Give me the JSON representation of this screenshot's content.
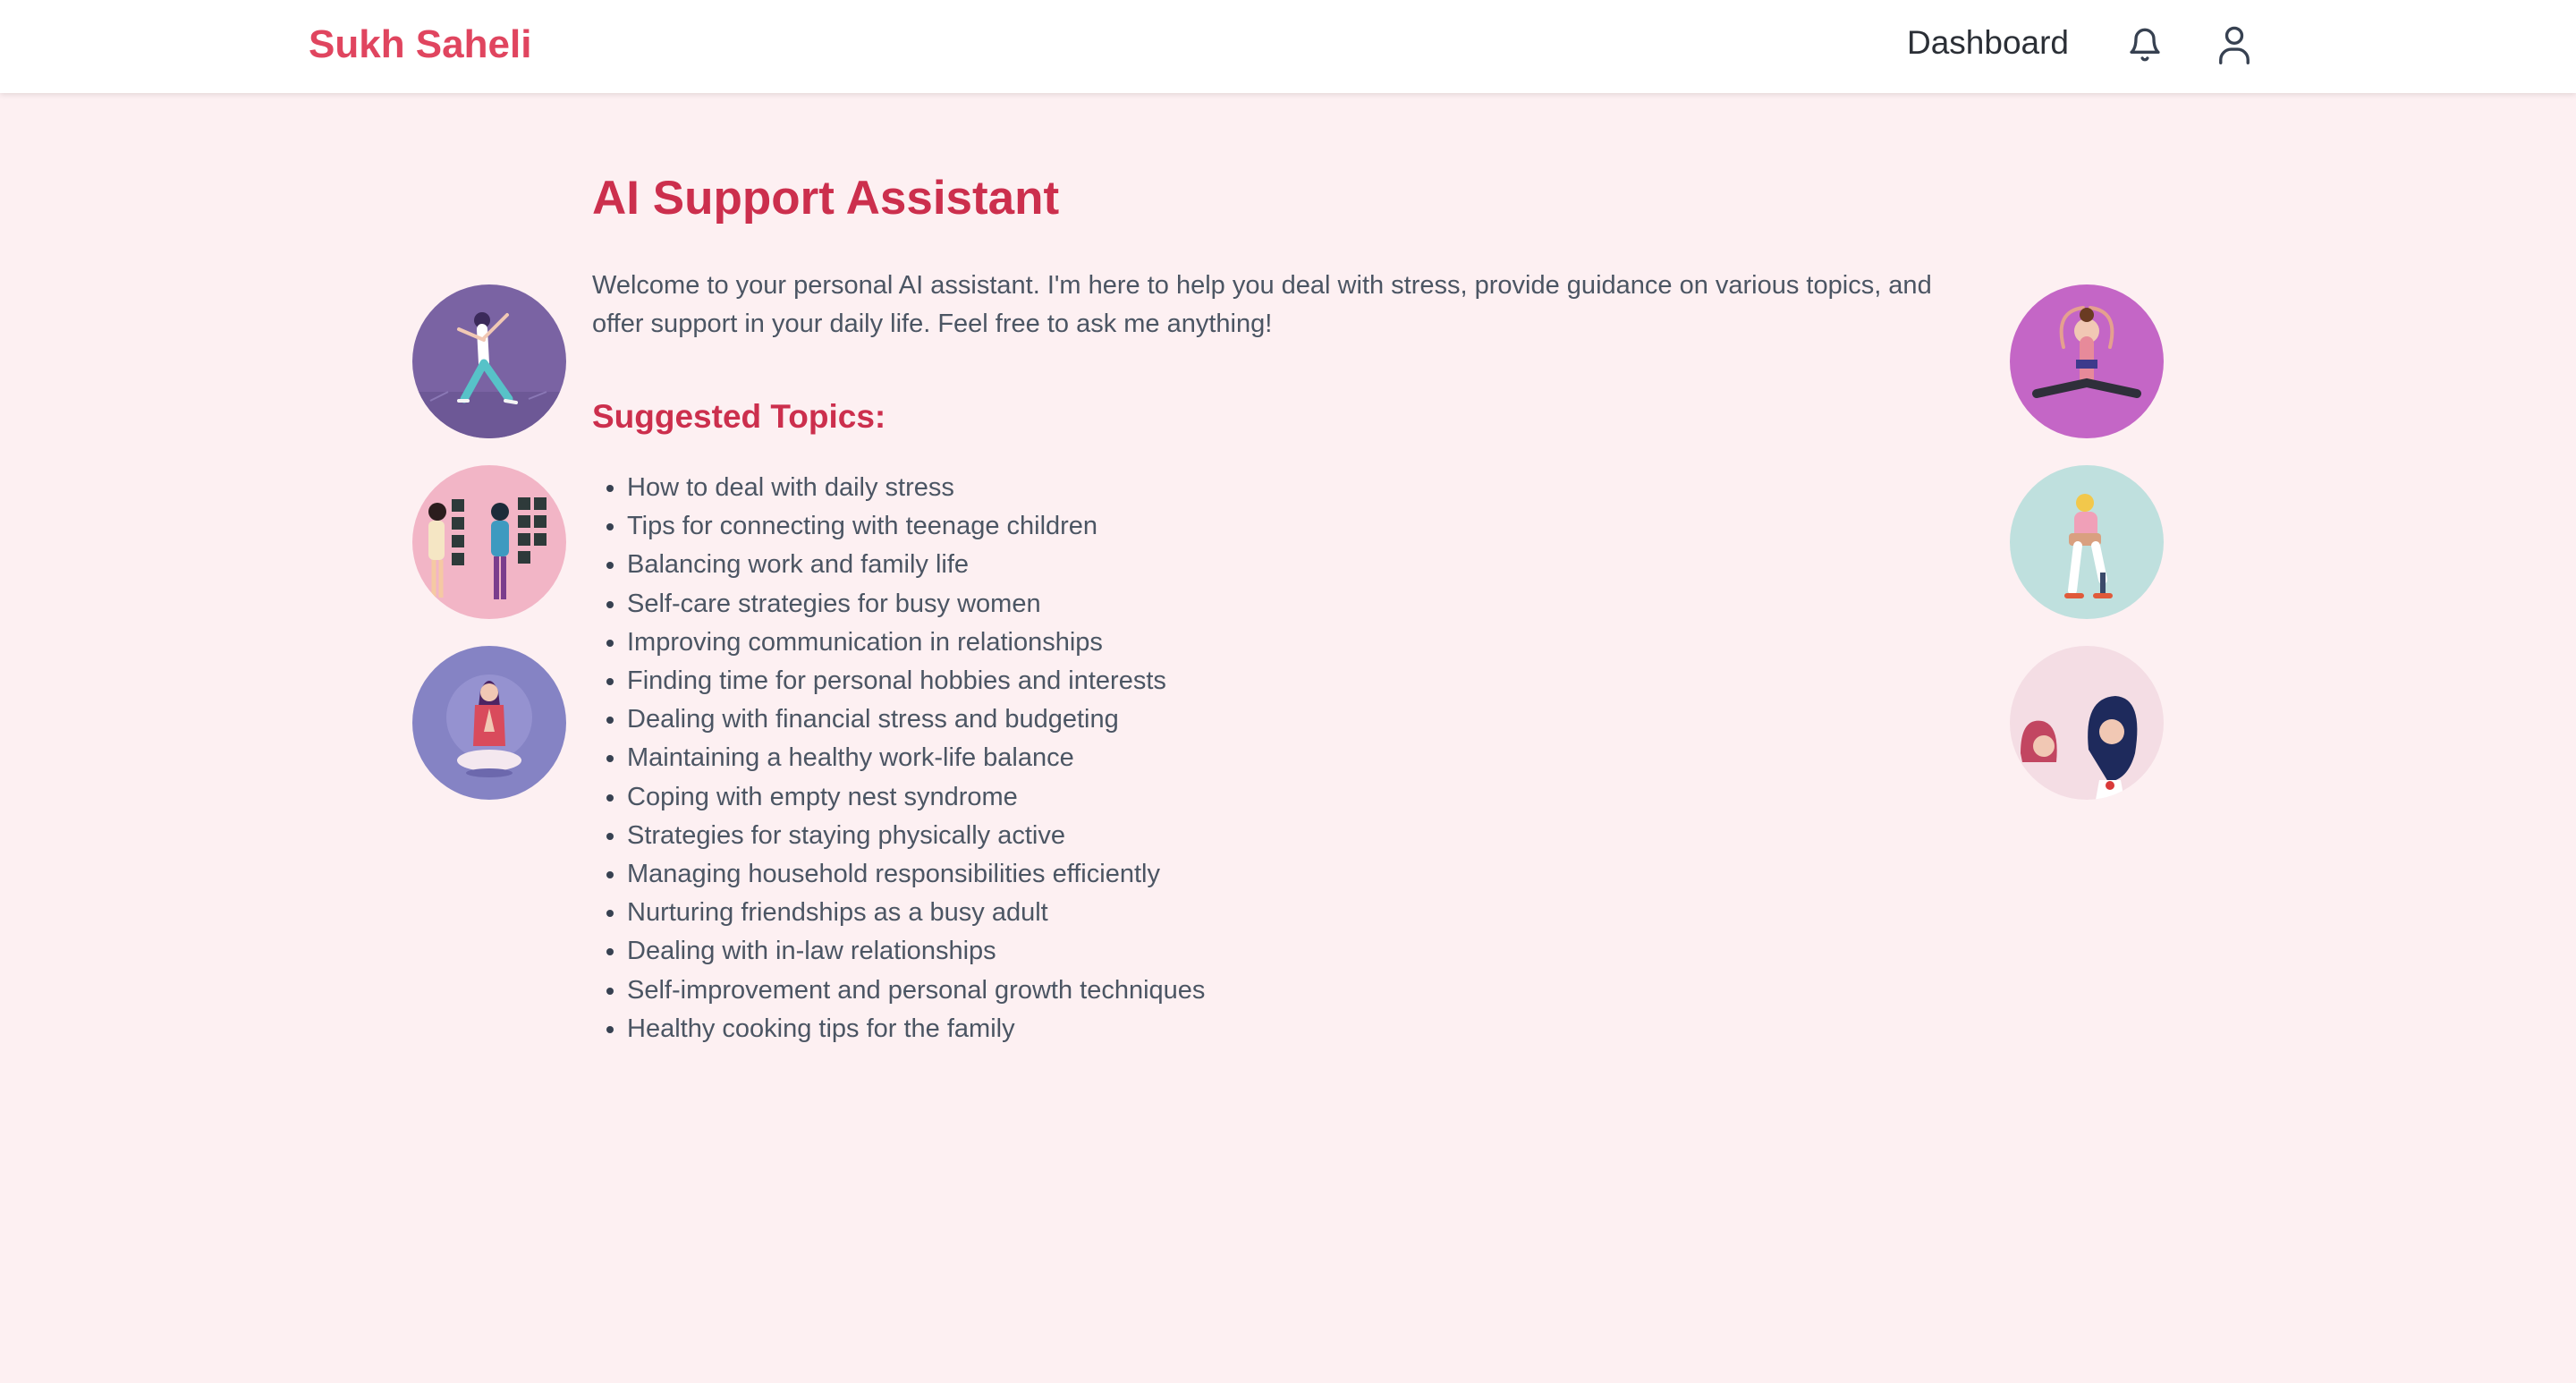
{
  "nav": {
    "brand": "Sukh Saheli",
    "dashboard_label": "Dashboard",
    "icons": [
      "bell-icon",
      "user-icon"
    ]
  },
  "main": {
    "title": "AI Support Assistant",
    "welcome": "Welcome to your personal AI assistant. I'm here to help you deal with stress, provide guidance on various topics, and offer support in your daily life. Feel free to ask me anything!",
    "topics_heading": "Suggested Topics:",
    "topics": [
      "How to deal with daily stress",
      "Tips for connecting with teenage children",
      "Balancing work and family life",
      "Self-care strategies for busy women",
      "Improving communication in relationships",
      "Finding time for personal hobbies and interests",
      "Dealing with financial stress and budgeting",
      "Maintaining a healthy work-life balance",
      "Coping with empty nest syndrome",
      "Strategies for staying physically active",
      "Managing household responsibilities efficiently",
      "Nurturing friendships as a busy adult",
      "Dealing with in-law relationships",
      "Self-improvement and personal growth techniques",
      "Healthy cooking tips for the family"
    ]
  },
  "illustrations": {
    "left": [
      "yoga-warrior-illustration",
      "ultrasound-couple-illustration",
      "meditation-illustration"
    ],
    "right": [
      "split-stretch-illustration",
      "leg-prosthesis-illustration",
      "two-women-illustration"
    ]
  },
  "colors": {
    "brand": "#e0455f",
    "heading": "#cc2f4d",
    "page_background": "#fdf0f2",
    "text": "#4b5563"
  }
}
